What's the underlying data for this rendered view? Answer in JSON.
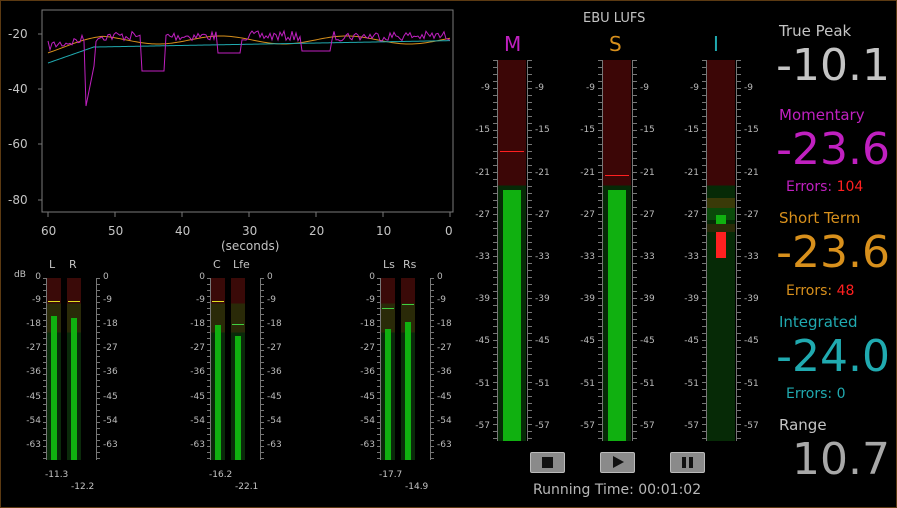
{
  "history": {
    "y_ticks": [
      "-20",
      "-40",
      "-60",
      "-80"
    ],
    "x_ticks": [
      "60",
      "50",
      "40",
      "30",
      "20",
      "10",
      "0"
    ],
    "x_unit": "(seconds)"
  },
  "channels": {
    "db_label": "dB",
    "scale": [
      "0",
      "-9",
      "-18",
      "-27",
      "-36",
      "-45",
      "-54",
      "-63"
    ],
    "meters": [
      {
        "label": "L",
        "peak": "-11.3",
        "level": 0.79,
        "hold": 0.87
      },
      {
        "label": "R",
        "peak": "-12.2",
        "level": 0.78,
        "hold": 0.87
      },
      {
        "label": "C",
        "peak": "-16.2",
        "level": 0.74,
        "hold": 0.87
      },
      {
        "label": "Lfe",
        "peak": "-22.1",
        "level": 0.68,
        "hold": 0.74
      },
      {
        "label": "Ls",
        "peak": "-17.7",
        "level": 0.72,
        "hold": 0.83
      },
      {
        "label": "Rs",
        "peak": "-14.9",
        "level": 0.76,
        "hold": 0.85
      }
    ]
  },
  "lufs": {
    "title": "EBU LUFS",
    "scale": [
      "-9",
      "-15",
      "-21",
      "-27",
      "-33",
      "-39",
      "-45",
      "-51",
      "-57"
    ],
    "bars": [
      {
        "label": "M",
        "color": "#c020c0",
        "level": 0.66
      },
      {
        "label": "S",
        "color": "#d8901c",
        "level": 0.66
      },
      {
        "label": "I",
        "color": "#20aab0",
        "level": 0
      }
    ],
    "running_time": "Running Time: 00:01:02"
  },
  "readouts": {
    "true_peak": {
      "label": "True Peak",
      "value": "-10.1"
    },
    "momentary": {
      "label": "Momentary",
      "value": "-23.6",
      "errors_label": "Errors: ",
      "errors_value": "104"
    },
    "short_term": {
      "label": "Short Term",
      "value": "-23.6",
      "errors_label": "Errors: ",
      "errors_value": "48"
    },
    "integrated": {
      "label": "Integrated",
      "value": "-24.0",
      "errors_label": "Errors: ",
      "errors_value": "0"
    },
    "range": {
      "label": "Range",
      "value": "10.7"
    }
  },
  "colors": {
    "momentary": "#c020c0",
    "short_term": "#d8901c",
    "integrated": "#20aab0",
    "error": "#ff2020",
    "meter_green": "#10b010"
  }
}
